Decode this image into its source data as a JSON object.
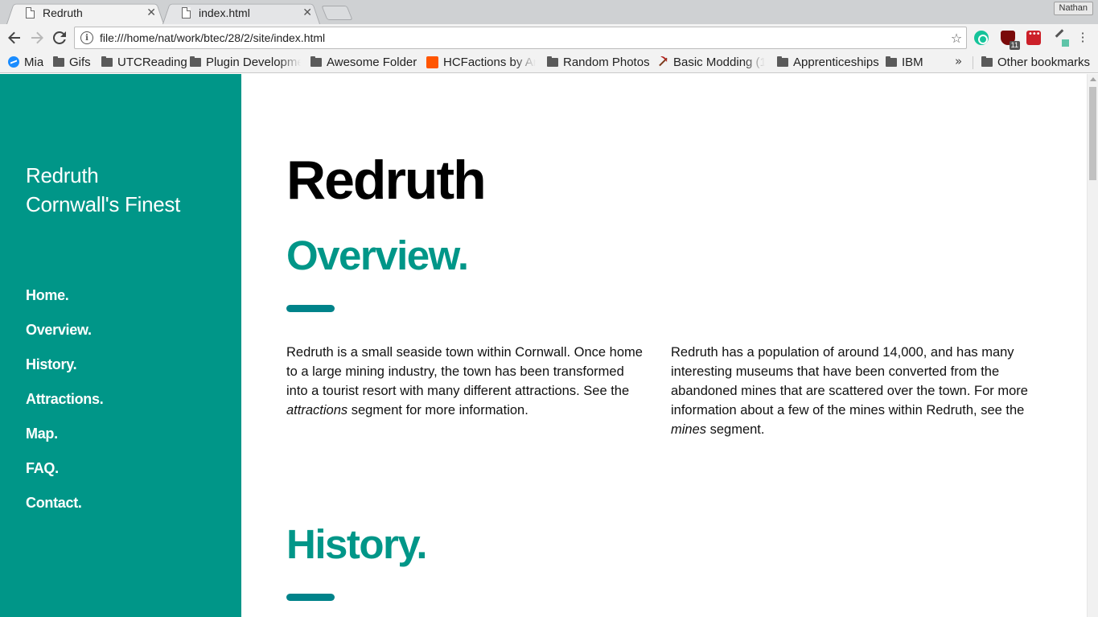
{
  "browser": {
    "tabs": [
      {
        "title": "Redruth",
        "close": "✕"
      },
      {
        "title": "index.html",
        "close": "✕"
      }
    ],
    "profile_name": "Nathan",
    "url": "file:///home/nat/work/btec/28/2/site/index.html",
    "extensions": {
      "ublock_badge": "11"
    },
    "bookmarks": [
      {
        "label": "Mia",
        "icon": "messenger-icon"
      },
      {
        "label": "Gifs",
        "icon": "folder-icon"
      },
      {
        "label": "UTCReading",
        "icon": "folder-icon"
      },
      {
        "label": "Plugin Developme",
        "icon": "folder-icon"
      },
      {
        "label": "Awesome Folder",
        "icon": "folder-icon"
      },
      {
        "label": "HCFactions by An",
        "icon": "soundcloud-icon"
      },
      {
        "label": "Random Photos",
        "icon": "folder-icon"
      },
      {
        "label": "Basic Modding (1",
        "icon": "pickaxe-icon"
      },
      {
        "label": "Apprenticeships",
        "icon": "folder-icon"
      },
      {
        "label": "IBM",
        "icon": "folder-icon"
      }
    ],
    "overflow_chevron": "»",
    "other_bookmarks": "Other bookmarks"
  },
  "sidebar": {
    "title": "Redruth",
    "subtitle": "Cornwall's Finest",
    "nav": [
      "Home.",
      "Overview.",
      "History.",
      "Attractions.",
      "Map.",
      "FAQ.",
      "Contact."
    ]
  },
  "main": {
    "page_title": "Redruth",
    "overview": {
      "heading": "Overview.",
      "left_paragraph": {
        "before": "Redruth is a small seaside town within Cornwall. Once home to a large mining industry, the town has been transformed into a tourist resort with many different attractions. See the ",
        "emphasis": "attractions",
        "after": " segment for more information."
      },
      "right_paragraph": {
        "before": "Redruth has a population of around 14,000, and has many interesting museums that have been converted from the abandoned mines that are scattered over the town. For more information about a few of the mines within Redruth, see the ",
        "emphasis": "mines",
        "after": " segment."
      }
    },
    "history": {
      "heading": "History."
    }
  },
  "colors": {
    "accent": "#009688",
    "accent_bar": "#00838a",
    "sidebar_text": "#ffffff"
  }
}
